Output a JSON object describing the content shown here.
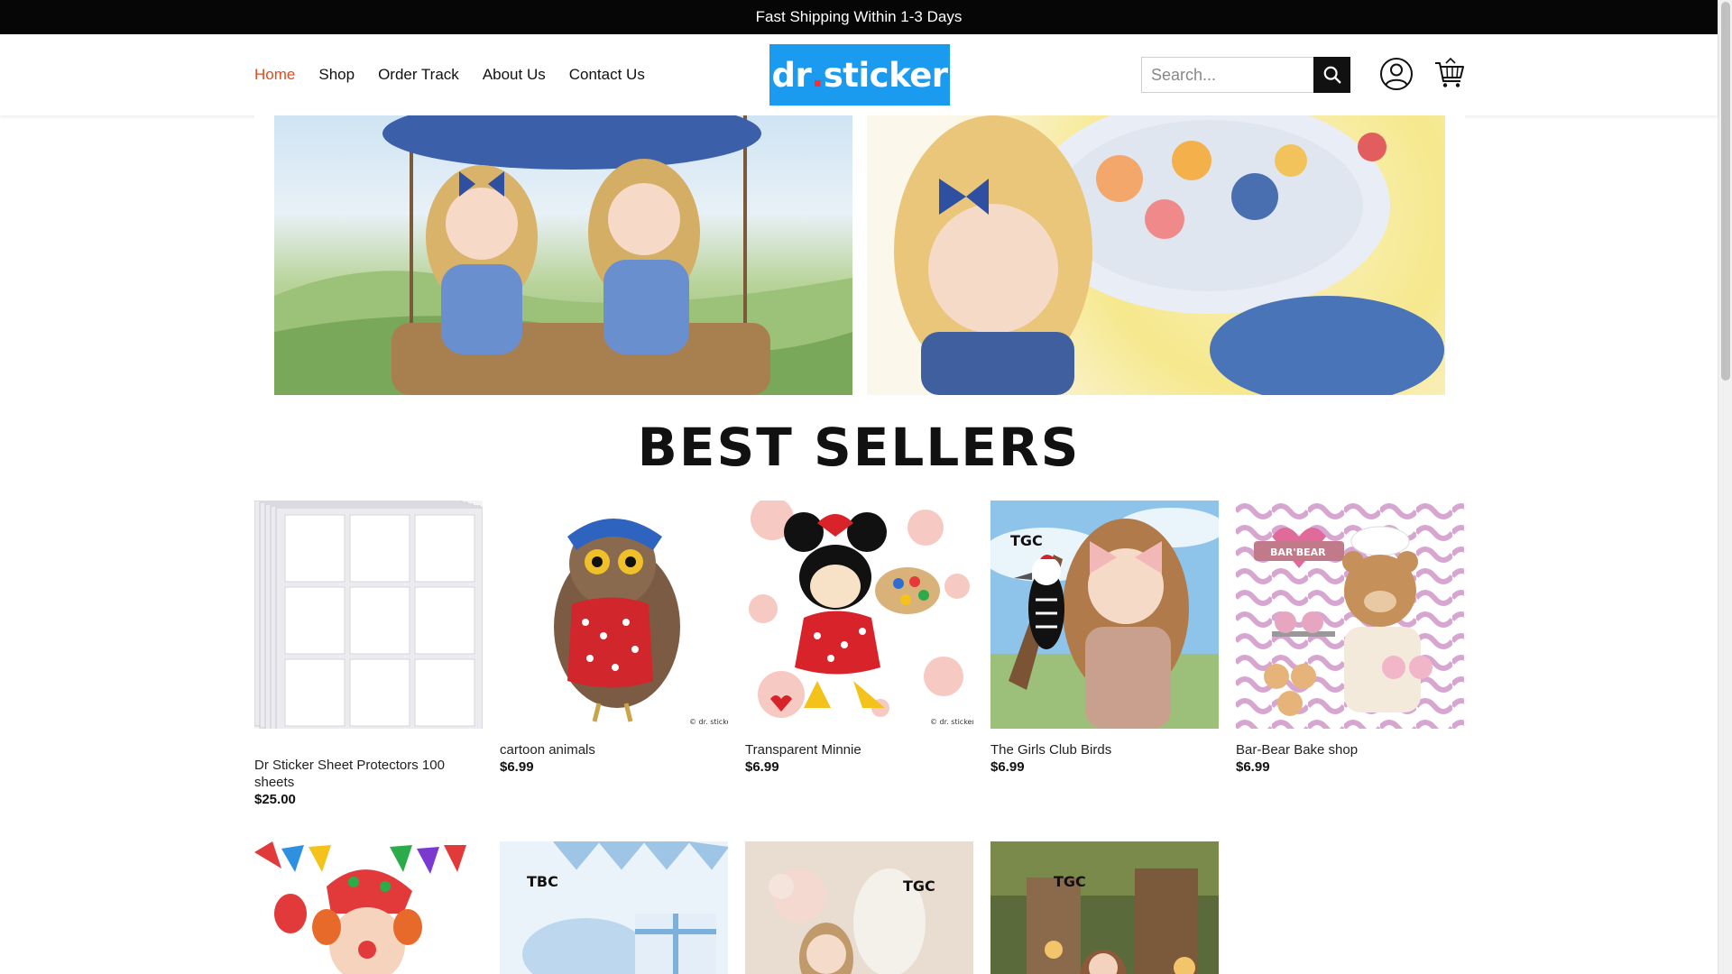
{
  "topbar": {
    "text": "Fast Shipping Within 1-3 Days"
  },
  "nav": {
    "items": [
      {
        "label": "Home",
        "active": true
      },
      {
        "label": "Shop"
      },
      {
        "label": "Order Track"
      },
      {
        "label": "About Us"
      },
      {
        "label": "Contact Us"
      }
    ]
  },
  "logo": {
    "text_main": "dr",
    "text_dot": ".",
    "text_end": "sticker",
    "bg_color": "#1a9bf0"
  },
  "search": {
    "placeholder": "Search...",
    "icon": "search-icon"
  },
  "header_icons": {
    "account": "user-icon",
    "cart": "cart-icon"
  },
  "colors": {
    "accent": "#e64a19",
    "topbar_bg": "#060606"
  },
  "section": {
    "title": "BEST SELLERS"
  },
  "products": [
    {
      "name": "Dr Sticker Sheet Protectors 100 sheets",
      "price": "$25.00"
    },
    {
      "name": "cartoon animals",
      "price": "$6.99"
    },
    {
      "name": "Transparent Minnie",
      "price": "$6.99"
    },
    {
      "name": "The Girls Club Birds",
      "price": "$6.99"
    },
    {
      "name": "Bar-Bear Bake shop",
      "price": "$6.99"
    }
  ],
  "image_marks": {
    "copyright": "© dr. sticker",
    "girls_club": "TGC",
    "baby_club": "TBC",
    "bear_sign": "BAR'BEAR"
  }
}
